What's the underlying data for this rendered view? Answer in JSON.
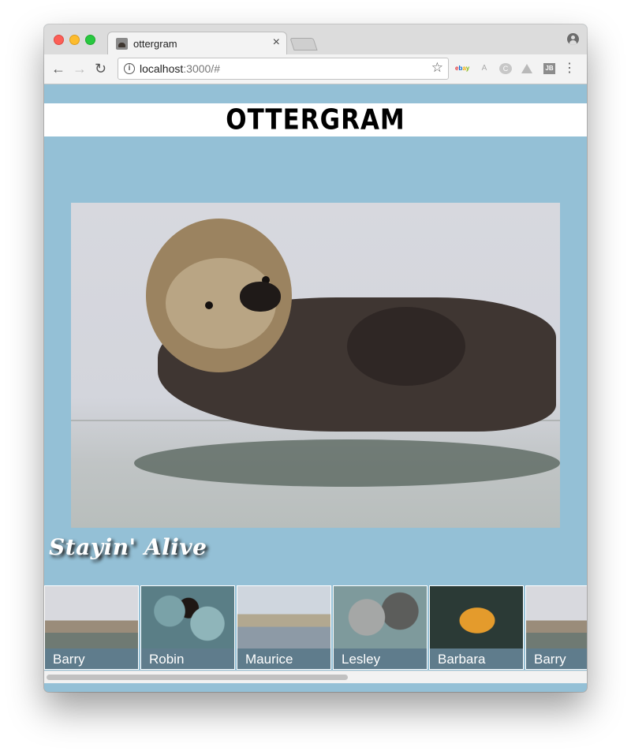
{
  "browser": {
    "tab_title": "ottergram",
    "tab_close": "×",
    "url_host": "localhost",
    "url_rest": ":3000/#",
    "back_glyph": "←",
    "forward_glyph": "→",
    "reload_glyph": "↻",
    "star_glyph": "☆",
    "menu_glyph": "⋮",
    "extensions": [
      "ebay-icon",
      "a-extension-icon",
      "c-extension-icon",
      "drive-icon",
      "jb-icon"
    ],
    "ext_jb_label": "JB",
    "ext_c_label": "C",
    "ext_a_label": "A",
    "ebay_letters": [
      "e",
      "b",
      "a",
      "y"
    ],
    "colors": {
      "close": "#fc5f57",
      "minimize": "#fdbc2e",
      "maximize": "#28c840"
    }
  },
  "page": {
    "logo": "OTTERGRAM",
    "background": "#94c0d6",
    "detail": {
      "title": "Stayin' Alive",
      "image": "otter-photo"
    },
    "thumbnails": [
      {
        "label": "Barry"
      },
      {
        "label": "Robin"
      },
      {
        "label": "Maurice"
      },
      {
        "label": "Lesley"
      },
      {
        "label": "Barbara"
      },
      {
        "label": "Barry"
      }
    ],
    "thumb_label_color": "#5f7c8c"
  }
}
